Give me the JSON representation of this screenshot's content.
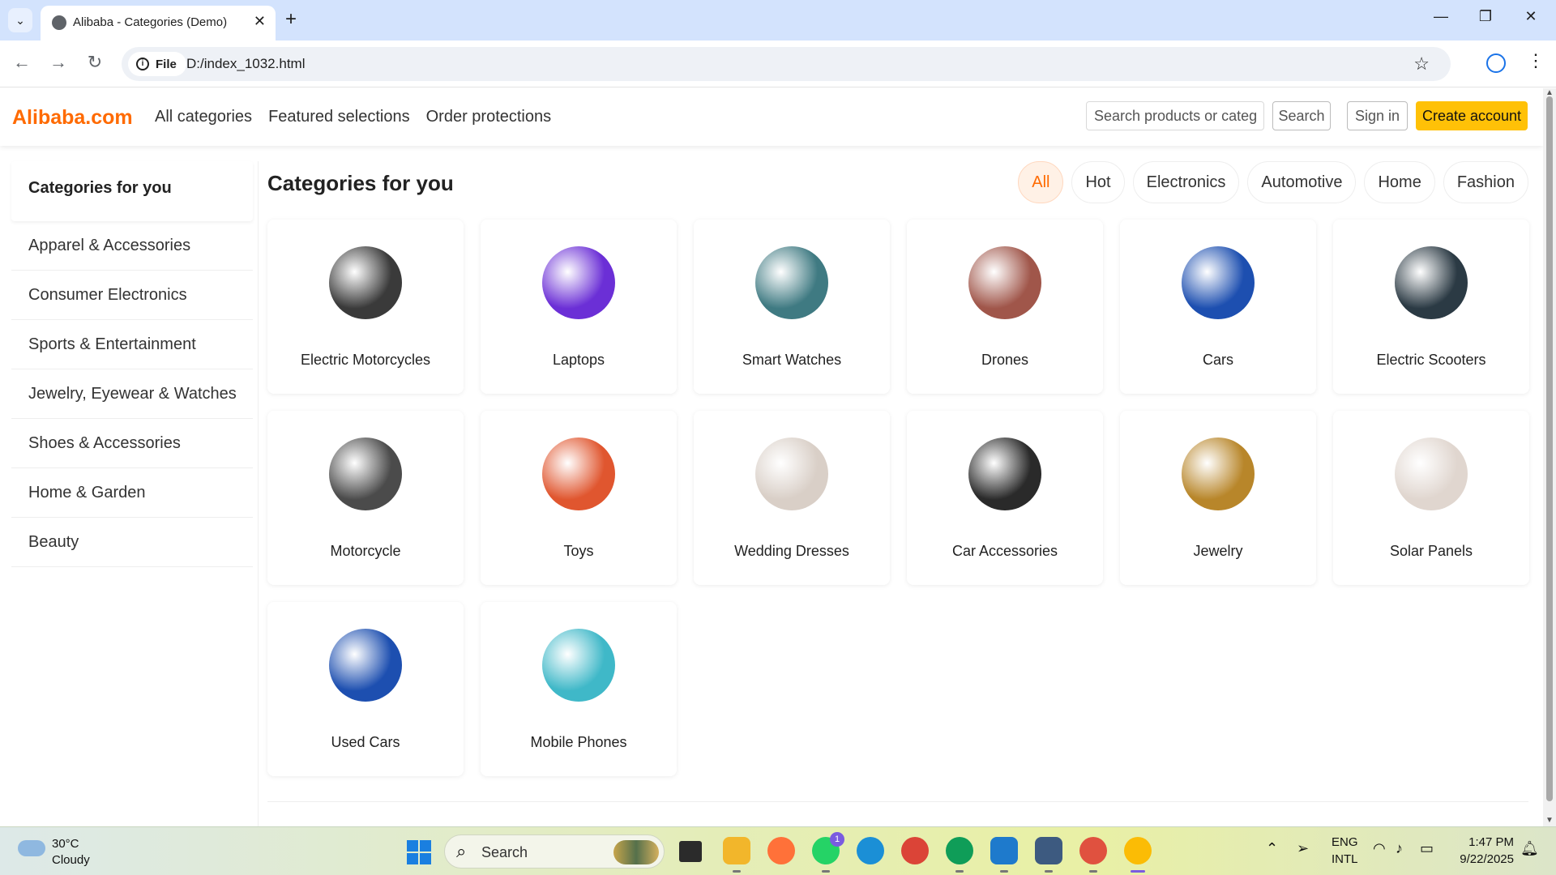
{
  "browser": {
    "tab_title": "Alibaba - Categories (Demo)",
    "url_chip": "File",
    "url": "D:/index_1032.html"
  },
  "header": {
    "logo": "Alibaba.com",
    "nav": [
      "All categories",
      "Featured selections",
      "Order protections"
    ],
    "search_placeholder": "Search products or categories",
    "search_label": "Search",
    "signin_label": "Sign in",
    "create_label": "Create account"
  },
  "sidebar": {
    "title": "Categories for you",
    "items": [
      "Apparel & Accessories",
      "Consumer Electronics",
      "Sports & Entertainment",
      "Jewelry, Eyewear & Watches",
      "Shoes & Accessories",
      "Home & Garden",
      "Beauty"
    ]
  },
  "main": {
    "title": "Categories for you",
    "filters": [
      "All",
      "Hot",
      "Electronics",
      "Automotive",
      "Home",
      "Fashion"
    ],
    "active_filter": "All",
    "cards": [
      {
        "label": "Electric Motorcycles",
        "icon": "electric-motorcycle-image",
        "color": "#3a3a3a"
      },
      {
        "label": "Laptops",
        "icon": "laptop-image",
        "color": "#6b2fd6"
      },
      {
        "label": "Smart Watches",
        "icon": "smart-watch-image",
        "color": "#3f7a82"
      },
      {
        "label": "Drones",
        "icon": "drones-image",
        "color": "#a0564a"
      },
      {
        "label": "Cars",
        "icon": "car-image",
        "color": "#1d4fb0"
      },
      {
        "label": "Electric Scooters",
        "icon": "electric-scooter-image",
        "color": "#2b3a44"
      },
      {
        "label": "Motorcycle",
        "icon": "motorcycle-image",
        "color": "#4b4b4b"
      },
      {
        "label": "Toys",
        "icon": "toys-image",
        "color": "#e0562f"
      },
      {
        "label": "Wedding Dresses",
        "icon": "wedding-dress-image",
        "color": "#d9cfc7"
      },
      {
        "label": "Car Accessories",
        "icon": "car-accessory-image",
        "color": "#2a2a2a"
      },
      {
        "label": "Jewelry",
        "icon": "jewelry-image",
        "color": "#b8862a"
      },
      {
        "label": "Solar Panels",
        "icon": "solar-panel-image",
        "color": "#e0d6cf"
      },
      {
        "label": "Used Cars",
        "icon": "used-car-image",
        "color": "#1d4fb0"
      },
      {
        "label": "Mobile Phones",
        "icon": "mobile-phone-image",
        "color": "#3fb8c8"
      }
    ]
  },
  "taskbar": {
    "weather_temp": "30°C",
    "weather_desc": "Cloudy",
    "search_label": "Search",
    "whatsapp_badge": "1",
    "lang_line1": "ENG",
    "lang_line2": "INTL",
    "time": "1:47 PM",
    "date": "9/22/2025"
  }
}
